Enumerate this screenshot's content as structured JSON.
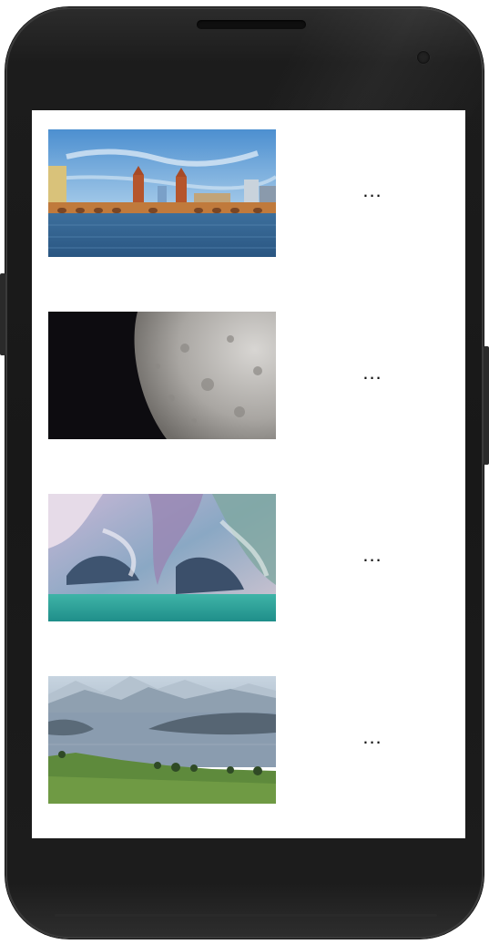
{
  "device": {
    "frame": "phone"
  },
  "list": {
    "items": [
      {
        "image": "bridge-river-photo",
        "more_label": "..."
      },
      {
        "image": "moon-photo",
        "more_label": "..."
      },
      {
        "image": "marble-caves-photo",
        "more_label": "..."
      },
      {
        "image": "mountain-lake-photo",
        "more_label": "..."
      }
    ]
  }
}
